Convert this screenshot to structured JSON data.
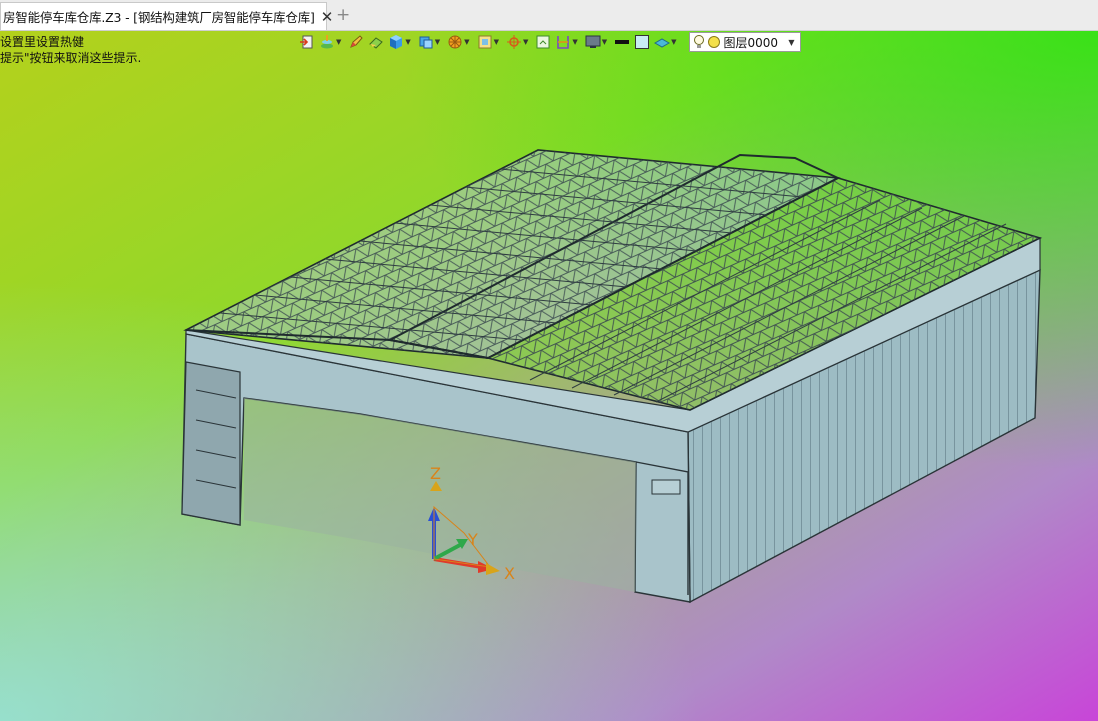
{
  "tab": {
    "title": "房智能停车库仓库.Z3 - [钢结构建筑厂房智能停车库仓库]",
    "close_glyph": "✕",
    "add_glyph": "+"
  },
  "hints": {
    "line1": "设置里设置热健",
    "line2": "提示\"按钮来取消这些提示."
  },
  "toolbar": {
    "buttons": [
      {
        "icon": "exit-sketch-icon",
        "dropdown": false
      },
      {
        "icon": "layer-manager-icon",
        "dropdown": true
      },
      {
        "icon": "pencil-icon",
        "dropdown": false
      },
      {
        "icon": "eraser-icon",
        "dropdown": false
      },
      {
        "icon": "solid-cube-icon",
        "dropdown": true
      },
      {
        "icon": "view-cube-icon",
        "dropdown": true
      },
      {
        "icon": "render-mode-icon",
        "dropdown": true
      },
      {
        "icon": "view-orient-icon",
        "dropdown": true
      },
      {
        "icon": "pan-target-icon",
        "dropdown": true
      },
      {
        "icon": "fit-view-icon",
        "dropdown": false
      },
      {
        "icon": "section-view-icon",
        "dropdown": true
      },
      {
        "icon": "display-settings-icon",
        "dropdown": true
      },
      {
        "icon": "line-style-icon",
        "dropdown": false
      },
      {
        "icon": "color-fill-icon",
        "dropdown": false
      },
      {
        "icon": "plane-icon",
        "dropdown": true
      }
    ],
    "layer": {
      "name": "图层0000",
      "bulb_icon": "lightbulb-icon",
      "color_icon": "layer-color-icon",
      "caret": "▼"
    }
  },
  "triad": {
    "x_label": "X",
    "y_label": "Y",
    "z_label": "Z",
    "colors": {
      "x": "#e03a2a",
      "y": "#2fa84a",
      "z": "#2a4fd6",
      "label": "#d8841a"
    }
  },
  "colors": {
    "model_fill": "#9ebac2",
    "model_edge": "#2a3438",
    "tab_bg": "#ffffff"
  }
}
